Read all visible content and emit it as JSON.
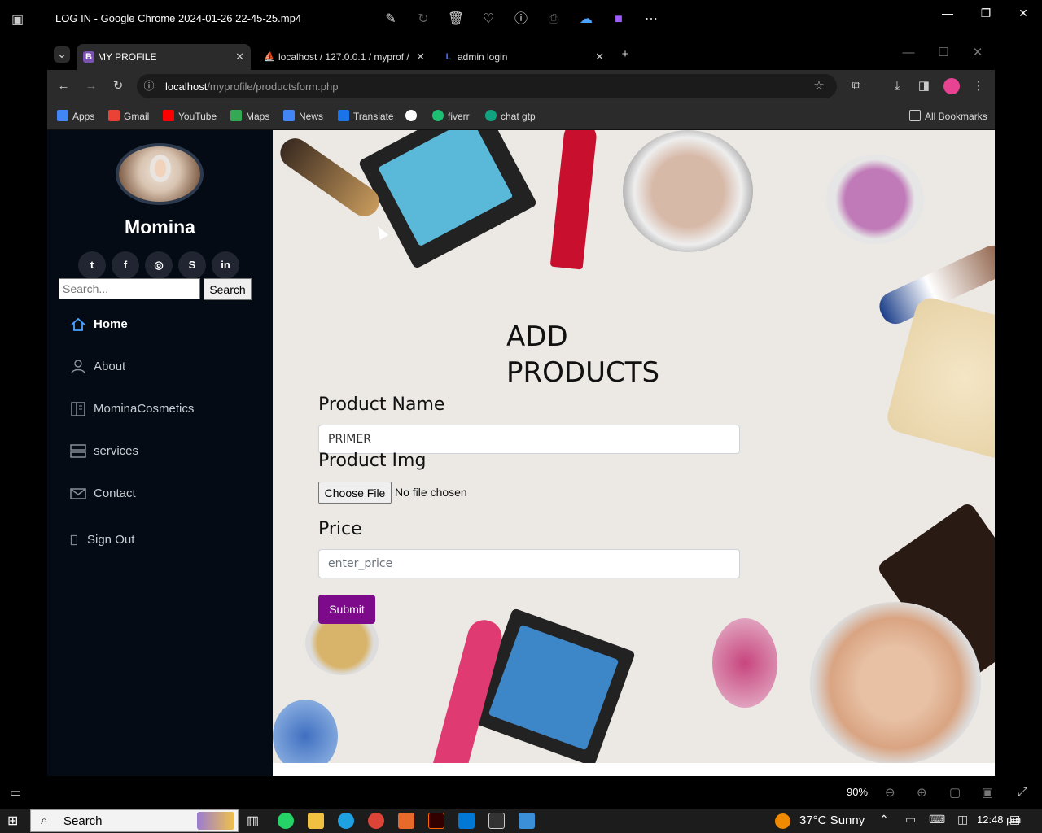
{
  "player": {
    "title": "LOG IN - Google Chrome 2024-01-26 22-45-25.mp4",
    "zoom": "90%"
  },
  "browser": {
    "tabs": [
      {
        "label": "MY PROFILE",
        "favicon": "B"
      },
      {
        "label": "localhost / 127.0.0.1 / myprof /",
        "favicon": ""
      },
      {
        "label": "admin login",
        "favicon": ""
      }
    ],
    "url_host": "localhost",
    "url_path": "/myprofile/productsform.php",
    "bookmarks": [
      "Apps",
      "Gmail",
      "YouTube",
      "Maps",
      "News",
      "Translate",
      "fiverr",
      "chat gtp"
    ],
    "all_bookmarks": "All Bookmarks"
  },
  "sidebar": {
    "name": "Momina",
    "social": [
      {
        "name": "twitter",
        "glyph": "t"
      },
      {
        "name": "facebook",
        "glyph": "f"
      },
      {
        "name": "instagram",
        "glyph": "◎"
      },
      {
        "name": "skype",
        "glyph": "S"
      },
      {
        "name": "linkedin",
        "glyph": "in"
      }
    ],
    "search_placeholder": "Search...",
    "search_button": "Search",
    "nav": [
      {
        "label": "Home",
        "icon": "home-icon"
      },
      {
        "label": "About",
        "icon": "person-icon"
      },
      {
        "label": "MominaCosmetics",
        "icon": "columns-icon"
      },
      {
        "label": "services",
        "icon": "server-icon"
      },
      {
        "label": "Contact",
        "icon": "envelope-icon"
      },
      {
        "label": "Sign Out",
        "icon": "door-icon"
      }
    ]
  },
  "form": {
    "title_line1": "ADD",
    "title_line2": "PRODUCTS",
    "product_name_label": "Product Name",
    "product_name_value": "PRIMER",
    "product_img_label": "Product Img",
    "choose_file": "Choose File",
    "file_status": "No file chosen",
    "price_label": "Price",
    "price_placeholder": "enter_price",
    "submit": "Submit",
    "submit_color": "#7d0a8a"
  },
  "taskbar": {
    "search": "Search",
    "weather": "37°C  Sunny",
    "time": "12:48 pm"
  }
}
